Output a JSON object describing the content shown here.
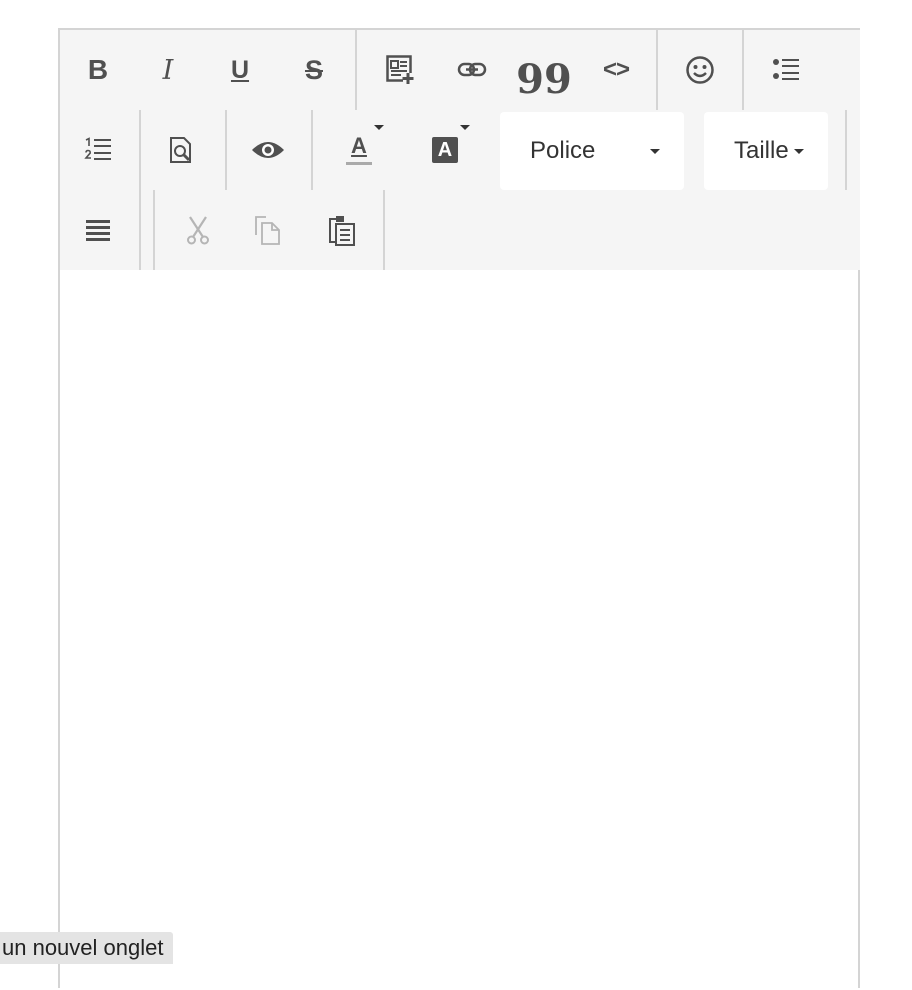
{
  "toolbar": {
    "bold_label": "B",
    "italic_label": "I",
    "underline_label": "U",
    "strike_label": "S",
    "quote_label": "99",
    "code_label": "<>",
    "font_select": "Police",
    "size_select": "Taille",
    "text_color_label": "A",
    "bg_color_label": "A"
  },
  "tooltip": {
    "text": "un nouvel onglet"
  },
  "colors": {
    "toolbar_bg": "#f5f5f5",
    "icon": "#505050",
    "border": "#d4d4d4",
    "disabled": "#b5b5b5"
  }
}
